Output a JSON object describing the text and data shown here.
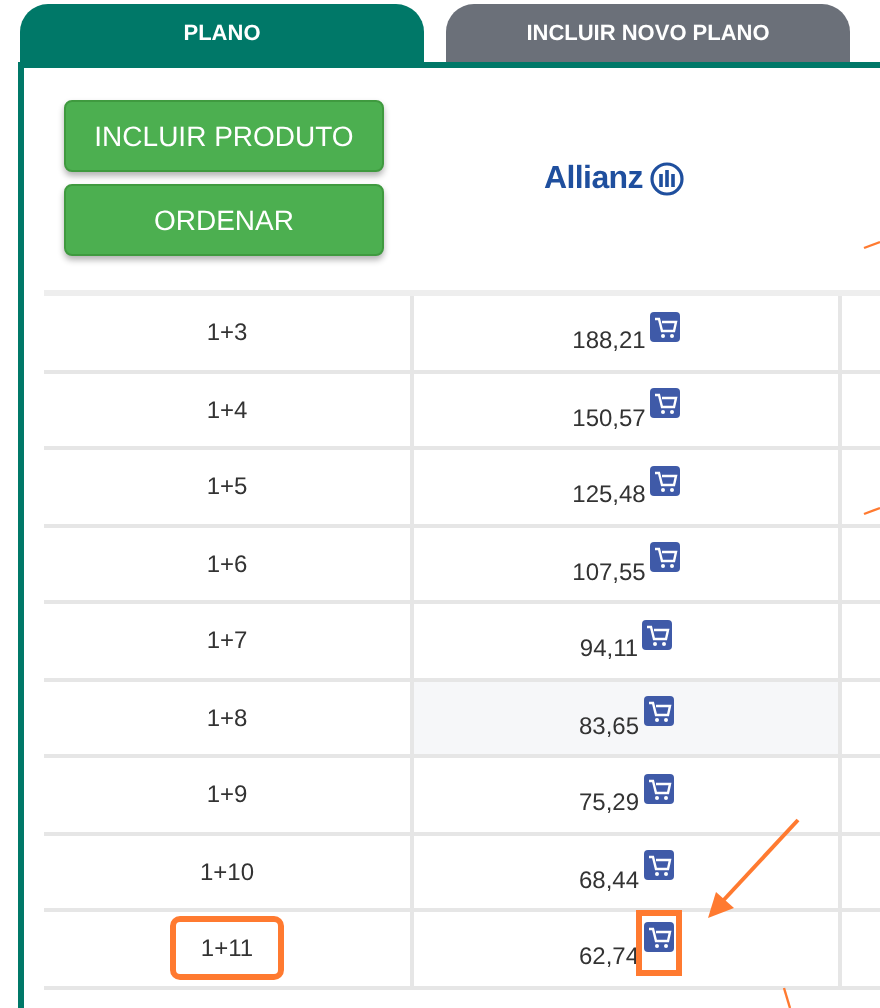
{
  "tabs": [
    {
      "label": "PLANO",
      "selected": true
    },
    {
      "label": "INCLUIR NOVO PLANO",
      "selected": false
    }
  ],
  "buttons": [
    "INCLUIR PRODUTO",
    "ORDENAR"
  ],
  "logo": {
    "text": "Allianz"
  },
  "rows": [
    {
      "plan": "1+3",
      "price": "188,21",
      "highlighted": false,
      "marked": false
    },
    {
      "plan": "1+4",
      "price": "150,57",
      "highlighted": false,
      "marked": false
    },
    {
      "plan": "1+5",
      "price": "125,48",
      "highlighted": false,
      "marked": false
    },
    {
      "plan": "1+6",
      "price": "107,55",
      "highlighted": false,
      "marked": false
    },
    {
      "plan": "1+7",
      "price": "94,11",
      "highlighted": false,
      "marked": false
    },
    {
      "plan": "1+8",
      "price": "83,65",
      "highlighted": true,
      "marked": false
    },
    {
      "plan": "1+9",
      "price": "75,29",
      "highlighted": false,
      "marked": false
    },
    {
      "plan": "1+10",
      "price": "68,44",
      "highlighted": false,
      "marked": false
    },
    {
      "plan": "1+11",
      "price": "62,74",
      "highlighted": false,
      "marked": true
    }
  ]
}
